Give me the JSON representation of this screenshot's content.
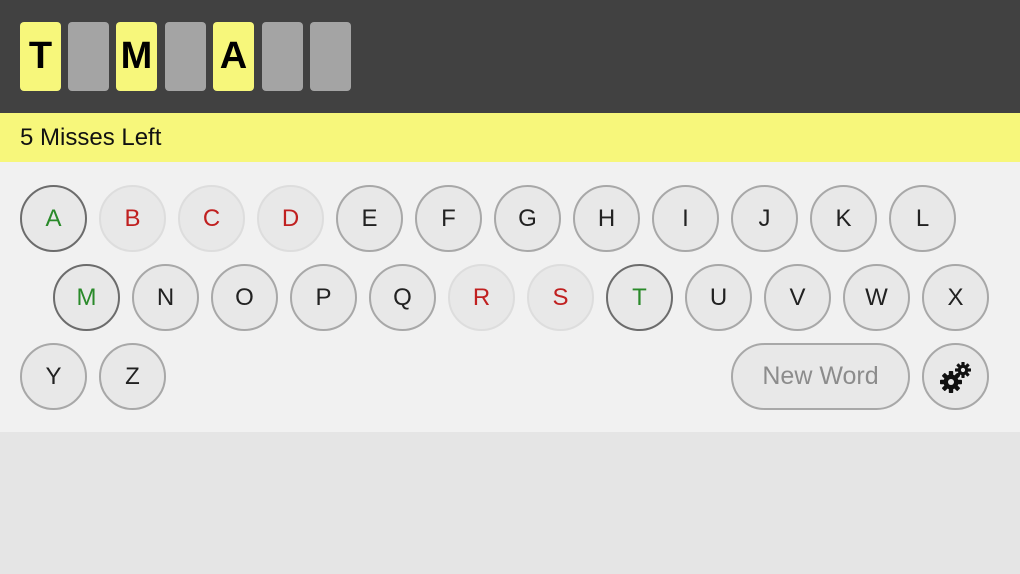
{
  "word": {
    "tiles": [
      {
        "letter": "T",
        "revealed": true
      },
      {
        "letter": "",
        "revealed": false
      },
      {
        "letter": "M",
        "revealed": true
      },
      {
        "letter": "",
        "revealed": false
      },
      {
        "letter": "A",
        "revealed": true
      },
      {
        "letter": "",
        "revealed": false
      },
      {
        "letter": "",
        "revealed": false
      }
    ]
  },
  "status": {
    "text": "5 Misses Left"
  },
  "keyboard": {
    "keys": [
      {
        "letter": "A",
        "state": "hit"
      },
      {
        "letter": "B",
        "state": "miss"
      },
      {
        "letter": "C",
        "state": "miss"
      },
      {
        "letter": "D",
        "state": "miss"
      },
      {
        "letter": "E",
        "state": "unused"
      },
      {
        "letter": "F",
        "state": "unused"
      },
      {
        "letter": "G",
        "state": "unused"
      },
      {
        "letter": "H",
        "state": "unused"
      },
      {
        "letter": "I",
        "state": "unused"
      },
      {
        "letter": "J",
        "state": "unused"
      },
      {
        "letter": "K",
        "state": "unused"
      },
      {
        "letter": "L",
        "state": "unused"
      },
      {
        "letter": "M",
        "state": "hit"
      },
      {
        "letter": "N",
        "state": "unused"
      },
      {
        "letter": "O",
        "state": "unused"
      },
      {
        "letter": "P",
        "state": "unused"
      },
      {
        "letter": "Q",
        "state": "unused"
      },
      {
        "letter": "R",
        "state": "miss"
      },
      {
        "letter": "S",
        "state": "miss"
      },
      {
        "letter": "T",
        "state": "hit"
      },
      {
        "letter": "U",
        "state": "unused"
      },
      {
        "letter": "V",
        "state": "unused"
      },
      {
        "letter": "W",
        "state": "unused"
      },
      {
        "letter": "X",
        "state": "unused"
      },
      {
        "letter": "Y",
        "state": "unused"
      },
      {
        "letter": "Z",
        "state": "unused"
      }
    ],
    "new_word_label": "New Word",
    "settings_icon": "gears-icon"
  },
  "colors": {
    "tile_revealed": "#f7f77b",
    "tile_hidden": "#a4a4a4",
    "hit_letter": "#2a8a2a",
    "miss_letter": "#c02020"
  }
}
